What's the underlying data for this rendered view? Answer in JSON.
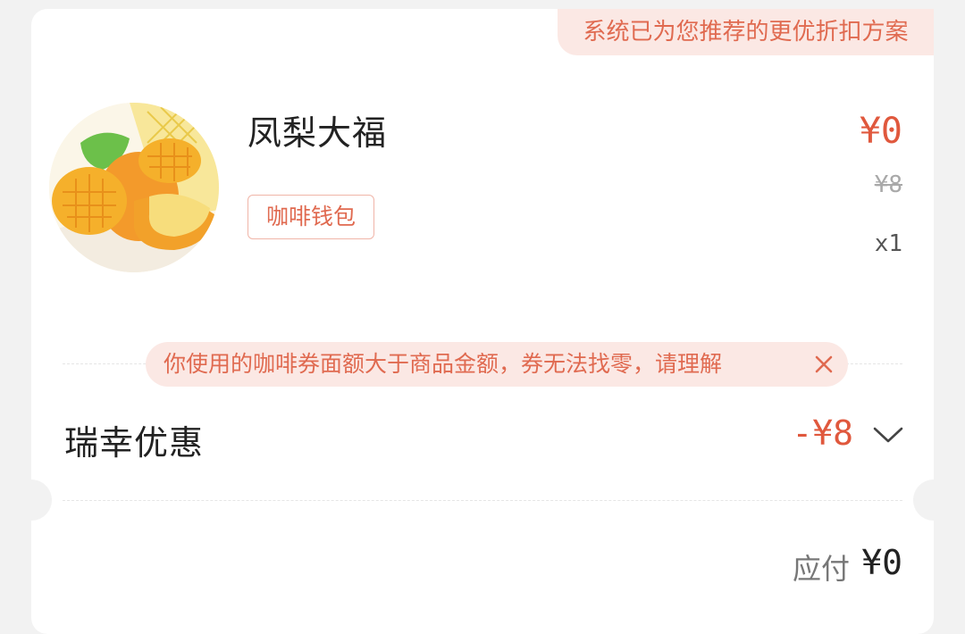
{
  "banner": {
    "recommend_text": "系统已为您推荐的更优折扣方案"
  },
  "product": {
    "name": "凤梨大福",
    "tag": "咖啡钱包",
    "price_now": "¥0",
    "price_original": "¥8",
    "quantity": "x1",
    "image_icon": "pineapple-mochi-photo"
  },
  "voucher_tip": {
    "text": "你使用的咖啡券面额大于商品金额，券无法找零，请理解",
    "close_icon": "close-icon"
  },
  "discount": {
    "label": "瑞幸优惠",
    "amount": "-¥8",
    "expand_icon": "chevron-down-icon"
  },
  "payment": {
    "label": "应付",
    "amount": "¥0"
  },
  "colors": {
    "accent": "#e0583d",
    "tip_bg": "#fbe8e4",
    "tip_text": "#e06a50"
  }
}
